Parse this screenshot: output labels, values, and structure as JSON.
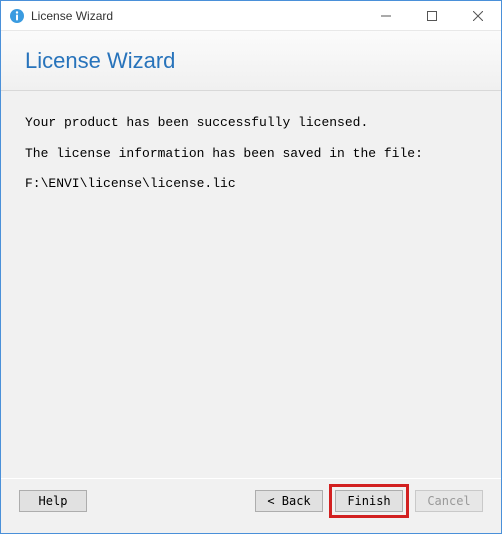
{
  "window": {
    "title": "License Wizard"
  },
  "header": {
    "title": "License Wizard"
  },
  "content": {
    "line1": "Your product has been successfully licensed.",
    "line2": "The license information has been saved in the file:",
    "line3": "F:\\ENVI\\license\\license.lic"
  },
  "footer": {
    "help_label": "Help",
    "back_label": "< Back",
    "finish_label": "Finish",
    "cancel_label": "Cancel"
  }
}
